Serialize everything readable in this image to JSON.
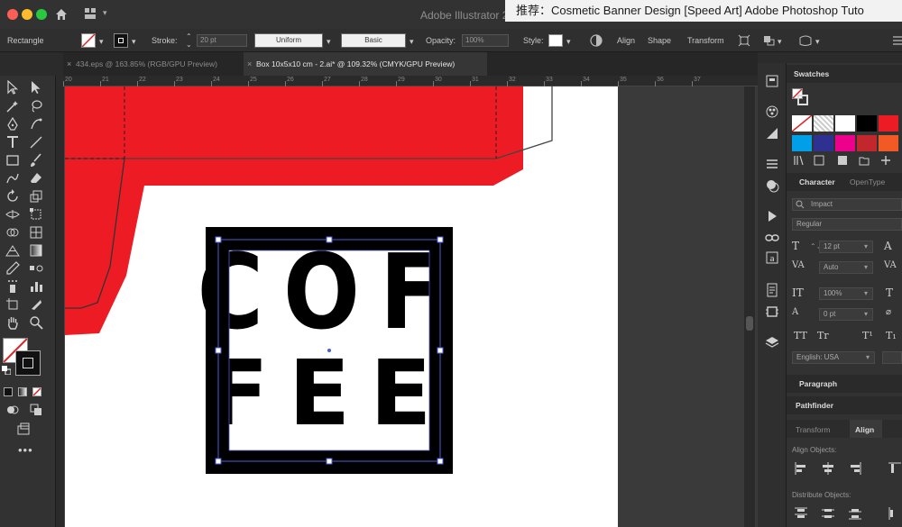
{
  "title_bar": {
    "app_title": "Adobe Illustrator 2",
    "banner_text": "推荐：Cosmetic Banner Design [Speed Art] Adobe Photoshop Tuto"
  },
  "control_bar": {
    "tool_name": "Rectangle",
    "stroke_label": "Stroke:",
    "stroke_weight": "20 pt",
    "profile": "Uniform",
    "brush": "Basic",
    "opacity_label": "Opacity:",
    "opacity_value": "100%",
    "style_label": "Style:",
    "align_label": "Align",
    "shape_label": "Shape",
    "transform_label": "Transform"
  },
  "tabs": [
    {
      "label": "434.eps @ 163.85% (RGB/GPU Preview)",
      "active": false
    },
    {
      "label": "Box 10x5x10 cm - 2.ai* @ 109.32% (CMYK/GPU Preview)",
      "active": true
    }
  ],
  "ruler": {
    "ticks": [
      "20",
      "21",
      "22",
      "23",
      "24",
      "25",
      "26",
      "27",
      "28",
      "29",
      "30",
      "31",
      "32",
      "33",
      "34",
      "35",
      "36",
      "37"
    ]
  },
  "artwork": {
    "line1": "COF",
    "line2": "FEE",
    "red_color": "#ed1c24"
  },
  "right_panel": {
    "swatches_tab": "Swatches",
    "character_tab": "Character",
    "opentype_tab": "OpenType",
    "font_family": "Impact",
    "font_style": "Regular",
    "font_size": "12 pt",
    "leading": "Auto",
    "scale": "100%",
    "tracking": "0 pt",
    "language": "English: USA",
    "paragraph_tab": "Paragraph",
    "pathfinder_tab": "Pathfinder",
    "transform_tab": "Transform",
    "align_tab": "Align",
    "align_objects_label": "Align Objects:",
    "distribute_objects_label": "Distribute Objects:",
    "glyph_tt": "TT",
    "glyph_tr": "Tr",
    "glyph_tsup": "T¹",
    "glyph_tsub": "T₁",
    "swatch_colors": [
      "#ffffff",
      "#000000",
      "#ed1c24",
      "#fcee21",
      "#00a0e9",
      "#2e3192",
      "#ec008c",
      "#c1272d",
      "#f15a24",
      "#ff0000"
    ]
  }
}
